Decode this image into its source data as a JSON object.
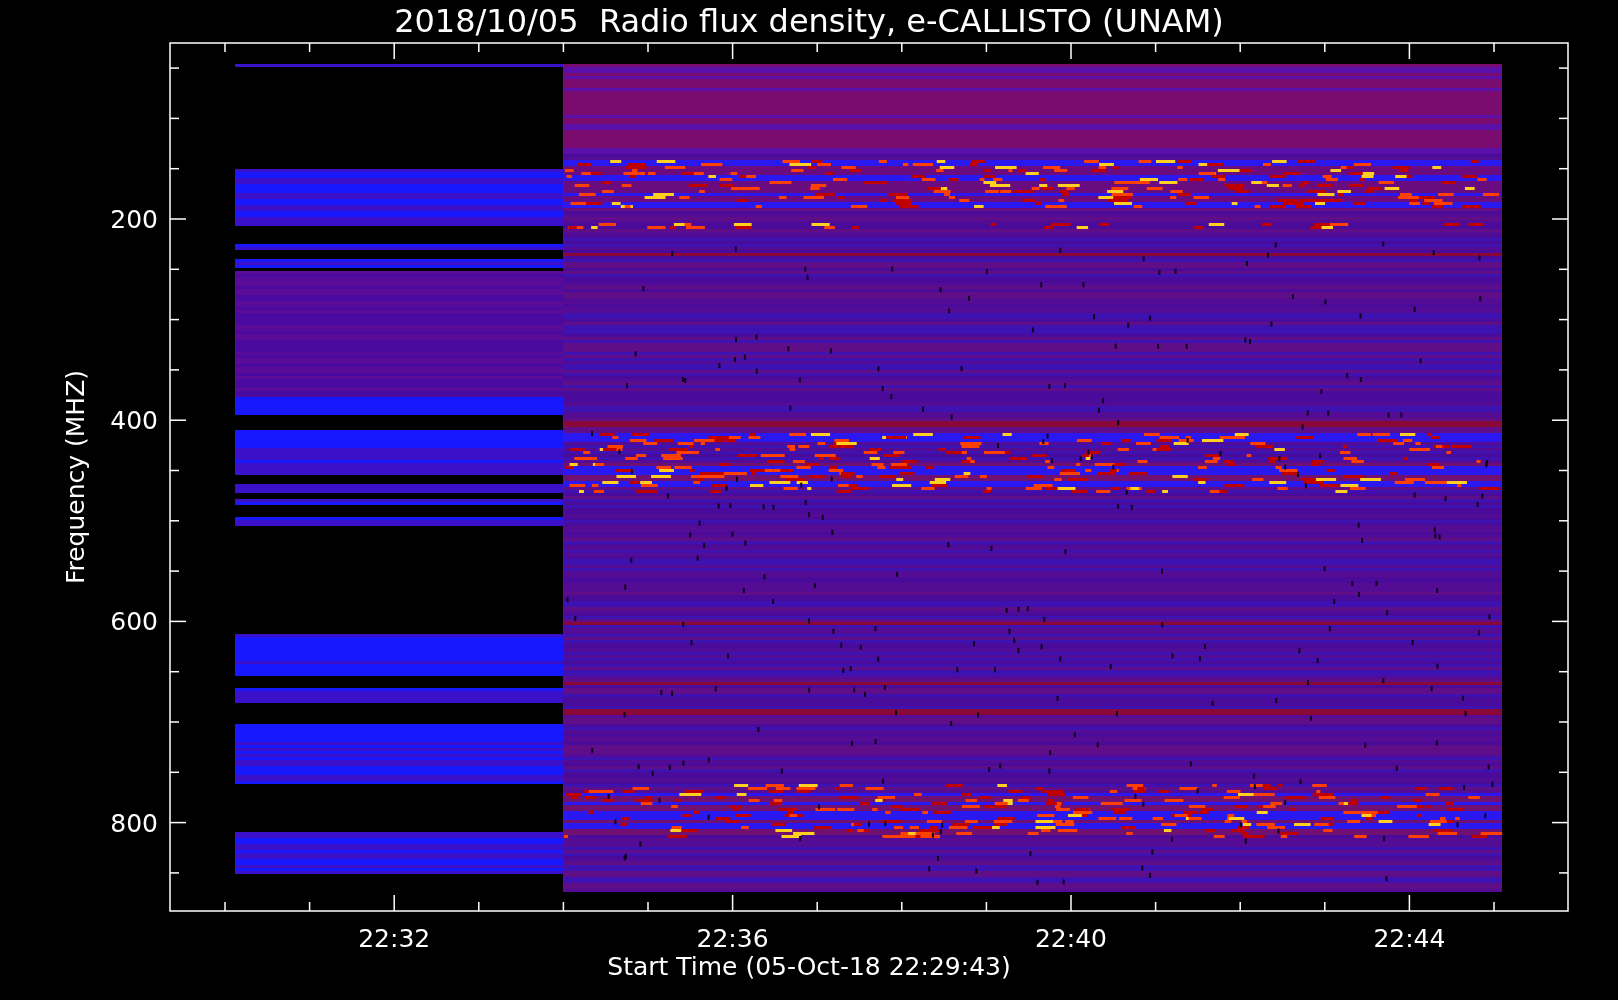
{
  "title": "2018/10/05  Radio flux density, e-CALLISTO (UNAM)",
  "ylabel": "Frequency (MHZ)",
  "xlabel": "Start Time (05-Oct-18 22:29:43)",
  "yticks": [
    "200",
    "400",
    "600",
    "800"
  ],
  "xticks": [
    "22:32",
    "22:36",
    "22:40",
    "22:44"
  ]
}
